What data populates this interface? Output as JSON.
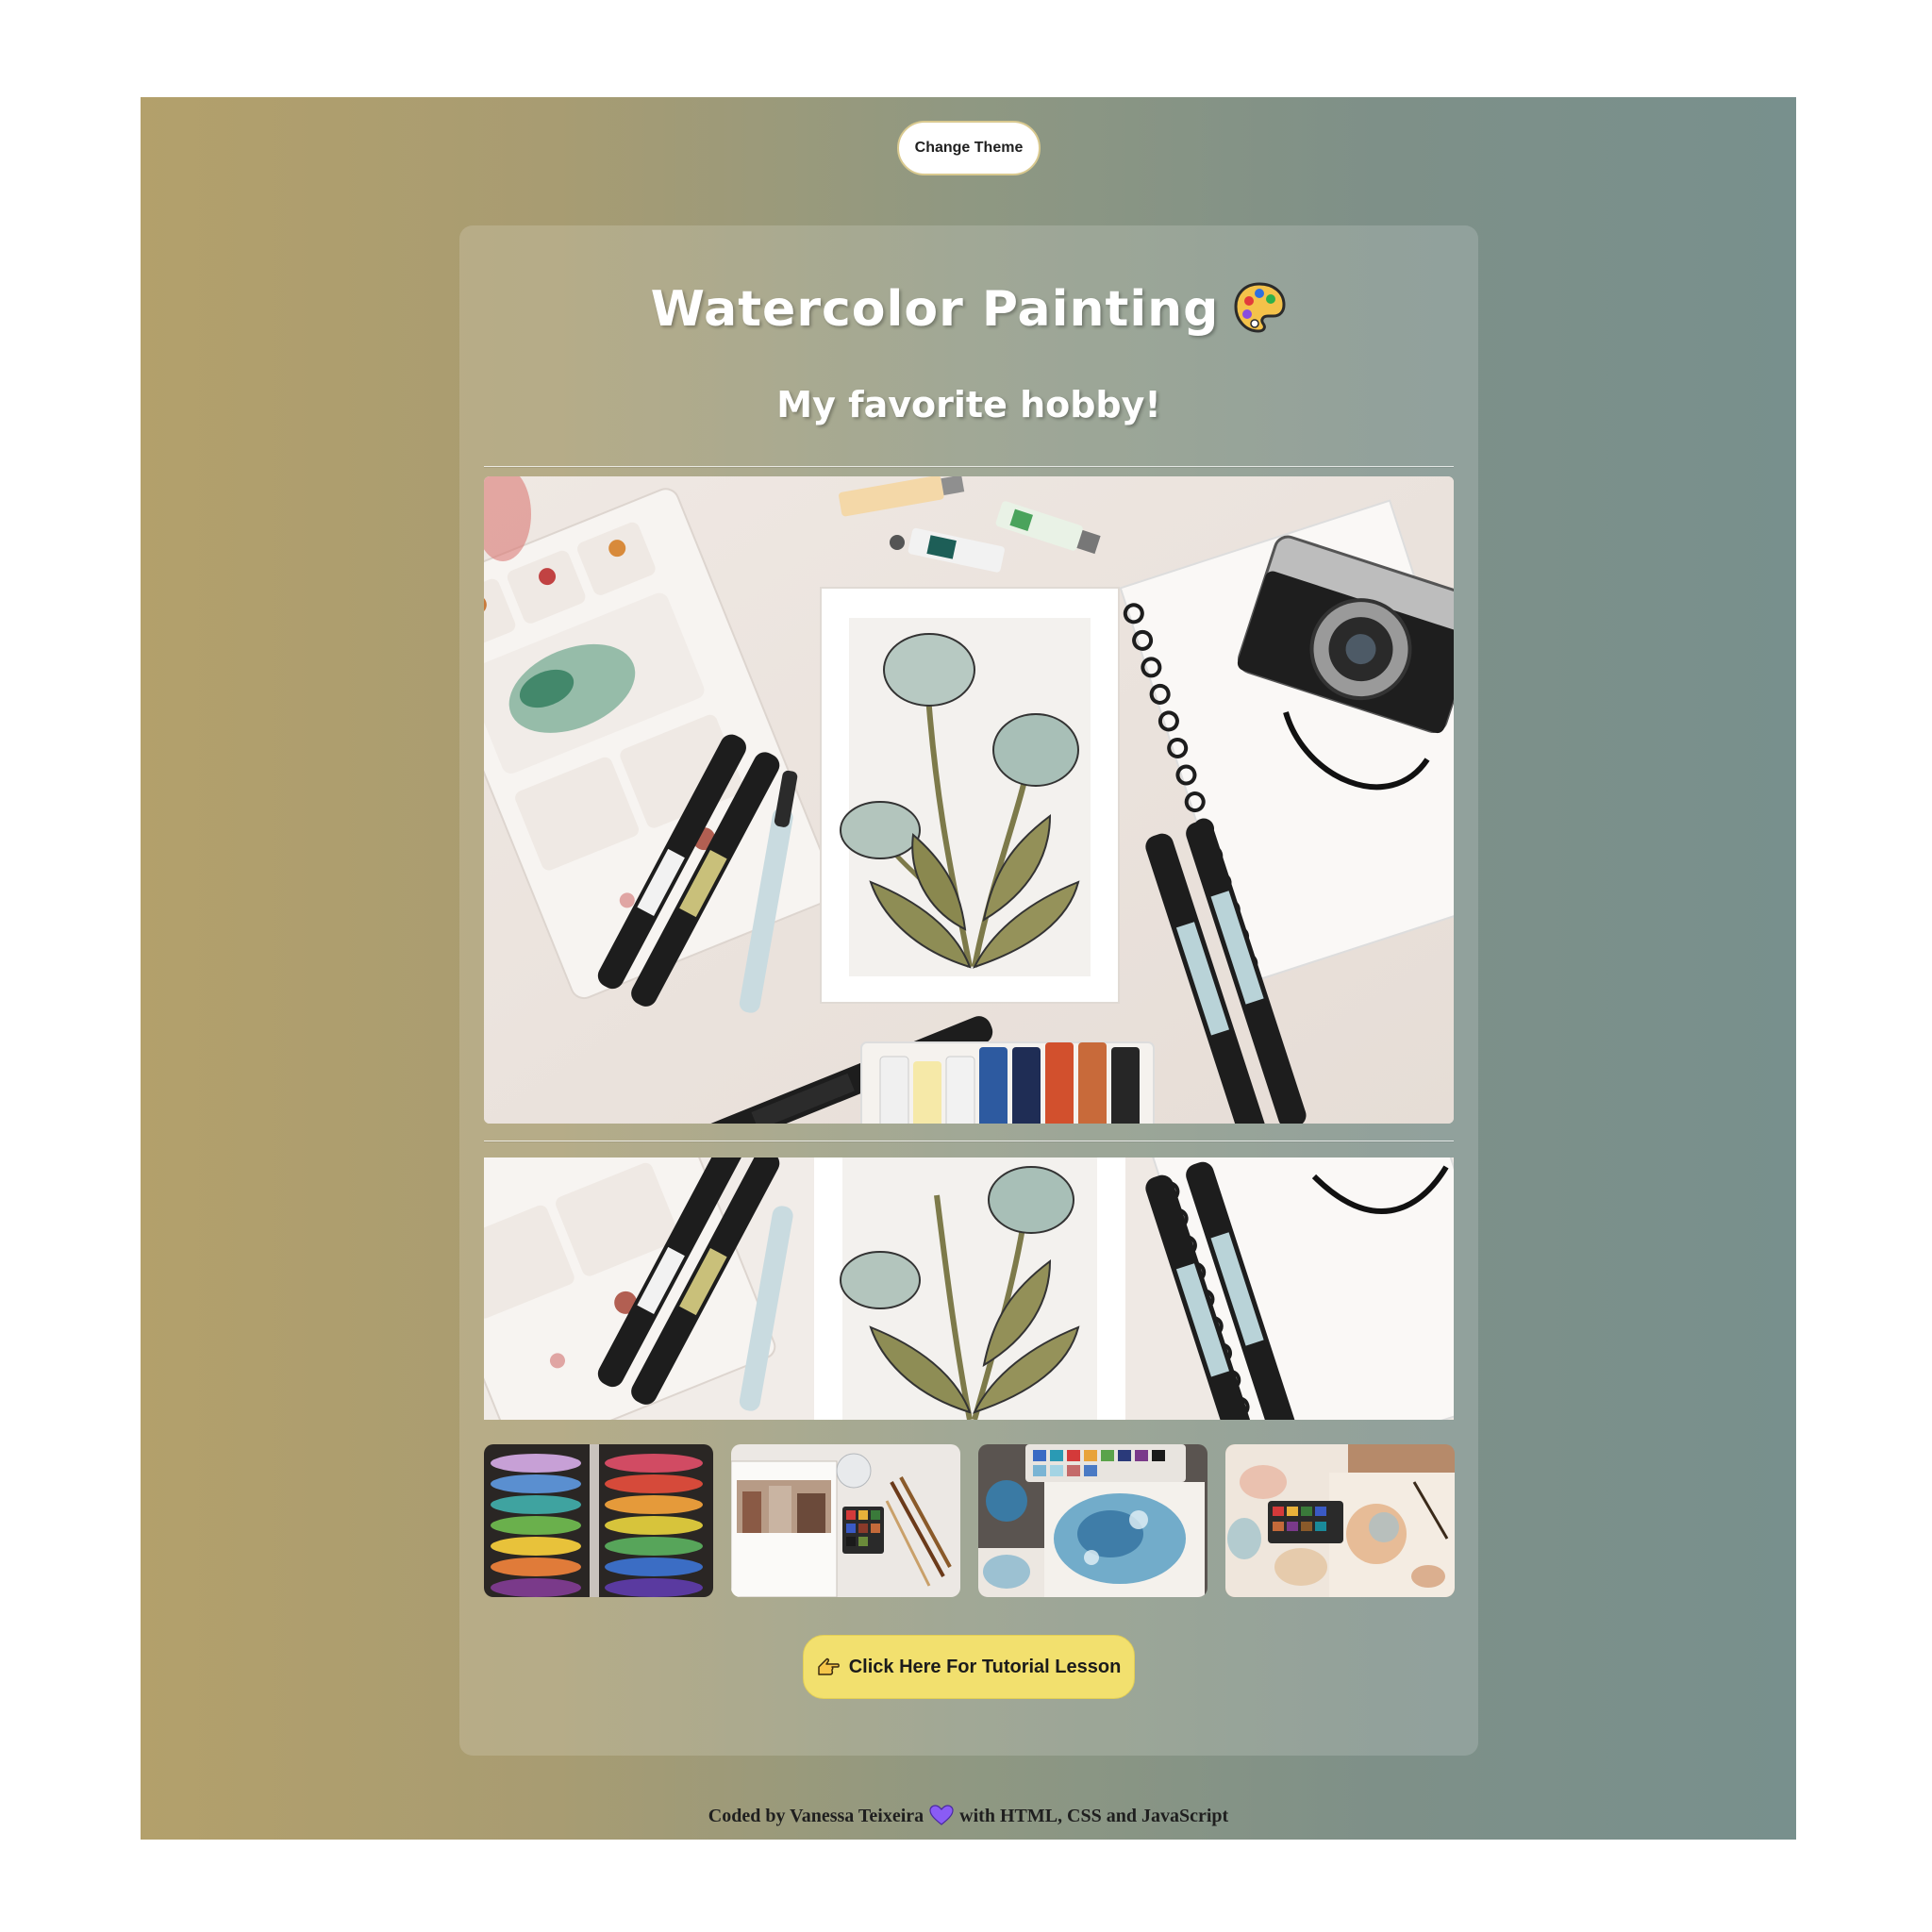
{
  "header": {
    "theme_button_label": "Change Theme"
  },
  "card": {
    "title": "Watercolor Painting",
    "title_icon": "artist-palette-icon",
    "subtitle": "My favorite hobby!",
    "tutorial_button_label": "Click Here For Tutorial Lesson",
    "tutorial_button_icon": "pointing-hand-icon"
  },
  "gallery": {
    "hero_image": "watercolor-flatlay-photo",
    "cropped_image": "watercolor-flatlay-crop-photo",
    "thumbnails": [
      {
        "name": "paint-palette-rainbow-photo"
      },
      {
        "name": "sketchbook-city-painting-photo"
      },
      {
        "name": "watercolor-blue-painting-photo"
      },
      {
        "name": "watercolor-sketches-table-photo"
      }
    ]
  },
  "footer": {
    "text_before": "Coded by Vanessa Teixeira",
    "text_after": "with HTML, CSS and JavaScript",
    "heart_icon": "purple-heart-icon"
  },
  "colors": {
    "gradient_left": "#b3a06b",
    "gradient_right": "#78908d",
    "tutorial_button": "#f2e06e",
    "heart": "#8a5cf5"
  }
}
